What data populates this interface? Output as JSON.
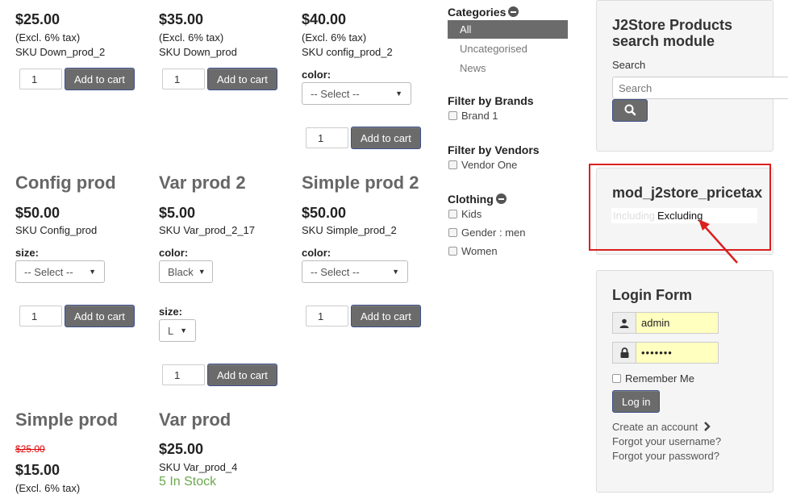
{
  "products": {
    "row1": [
      {
        "price": "$25.00",
        "tax": "(Excl. 6% tax)",
        "sku": "SKU Down_prod_2",
        "qty": "1",
        "cart": "Add to cart"
      },
      {
        "price": "$35.00",
        "tax": "(Excl. 6% tax)",
        "sku": "SKU Down_prod",
        "qty": "1",
        "cart": "Add to cart"
      },
      {
        "price": "$40.00",
        "tax": "(Excl. 6% tax)",
        "sku": "SKU config_prod_2",
        "option_label": "color:",
        "option_value": "-- Select --",
        "qty": "1",
        "cart": "Add to cart"
      }
    ],
    "row2": [
      {
        "title": "Config prod",
        "price": "$50.00",
        "sku": "SKU Config_prod",
        "option_label": "size:",
        "option_value": "-- Select --",
        "qty": "1",
        "cart": "Add to cart"
      },
      {
        "title": "Var prod 2",
        "price": "$5.00",
        "sku": "SKU Var_prod_2_17",
        "option_label": "color:",
        "option_value": "Black",
        "option2_label": "size:",
        "option2_value": "L",
        "qty": "1",
        "cart": "Add to cart"
      },
      {
        "title": "Simple prod 2",
        "price": "$50.00",
        "sku": "SKU Simple_prod_2",
        "option_label": "color:",
        "option_value": "-- Select --",
        "qty": "1",
        "cart": "Add to cart"
      }
    ],
    "row3": [
      {
        "title": "Simple prod",
        "old_price": "$25.00",
        "price": "$15.00",
        "tax": "(Excl. 6% tax)"
      },
      {
        "title": "Var prod",
        "price": "$25.00",
        "sku": "SKU Var_prod_4",
        "stock": "5 In Stock"
      }
    ]
  },
  "filters": {
    "categories_title": "Categories",
    "categories": [
      "All",
      "Uncategorised",
      "News"
    ],
    "brands_title": "Filter by Brands",
    "brands": [
      "Brand 1"
    ],
    "vendors_title": "Filter by Vendors",
    "vendors": [
      "Vendor One"
    ],
    "clothing_title": "Clothing",
    "clothing": [
      "Kids",
      "Gender : men",
      "Women"
    ]
  },
  "search_module": {
    "title": "J2Store Products search module",
    "label": "Search",
    "placeholder": "Search"
  },
  "pricetax_module": {
    "title": "mod_j2store_pricetax",
    "option_including": "Including",
    "option_excluding": "Excluding"
  },
  "login": {
    "title": "Login Form",
    "username": "admin",
    "password": "•••••••",
    "remember": "Remember Me",
    "button": "Log in",
    "create_account": "Create an account",
    "forgot_username": "Forgot your username?",
    "forgot_password": "Forgot your password?"
  },
  "colors": {
    "highlight_border": "#d9201f",
    "button_bg": "#6b6b6b",
    "in_stock": "#6aa84f",
    "old_price": "#e00000"
  }
}
